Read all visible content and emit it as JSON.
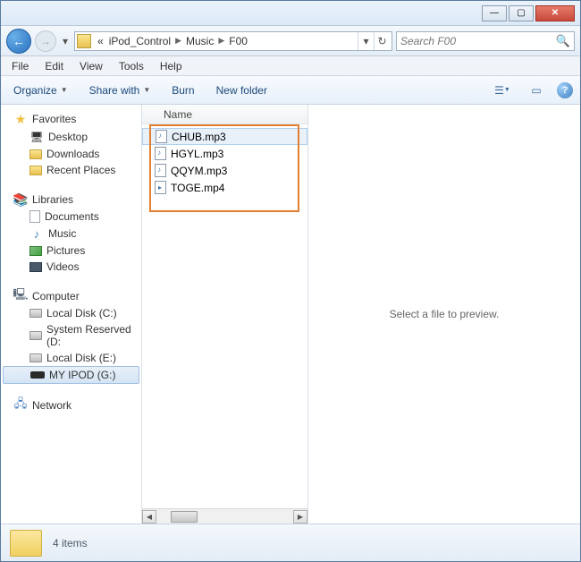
{
  "window": {
    "min": "—",
    "max": "▢",
    "close": "✕"
  },
  "nav": {
    "back": "←",
    "forward": "→"
  },
  "breadcrumb": {
    "prefix": "«",
    "segments": [
      "iPod_Control",
      "Music",
      "F00"
    ]
  },
  "search": {
    "placeholder": "Search F00",
    "icon": "🔍"
  },
  "menu": {
    "file": "File",
    "edit": "Edit",
    "view": "View",
    "tools": "Tools",
    "help": "Help"
  },
  "toolbar": {
    "organize": "Organize",
    "share": "Share with",
    "burn": "Burn",
    "newfolder": "New folder"
  },
  "navpane": {
    "favorites": {
      "label": "Favorites",
      "items": [
        "Desktop",
        "Downloads",
        "Recent Places"
      ]
    },
    "libraries": {
      "label": "Libraries",
      "items": [
        "Documents",
        "Music",
        "Pictures",
        "Videos"
      ]
    },
    "computer": {
      "label": "Computer",
      "items": [
        "Local Disk (C:)",
        "System Reserved (D:",
        "Local Disk (E:)",
        "MY IPOD (G:)"
      ]
    },
    "network": {
      "label": "Network"
    }
  },
  "files": {
    "header": "Name",
    "items": [
      {
        "name": "CHUB.mp3",
        "type": "mp3"
      },
      {
        "name": "HGYL.mp3",
        "type": "mp3"
      },
      {
        "name": "QQYM.mp3",
        "type": "mp3"
      },
      {
        "name": "TOGE.mp4",
        "type": "mp4"
      }
    ]
  },
  "preview": {
    "empty": "Select a file to preview."
  },
  "status": {
    "count": "4 items"
  }
}
